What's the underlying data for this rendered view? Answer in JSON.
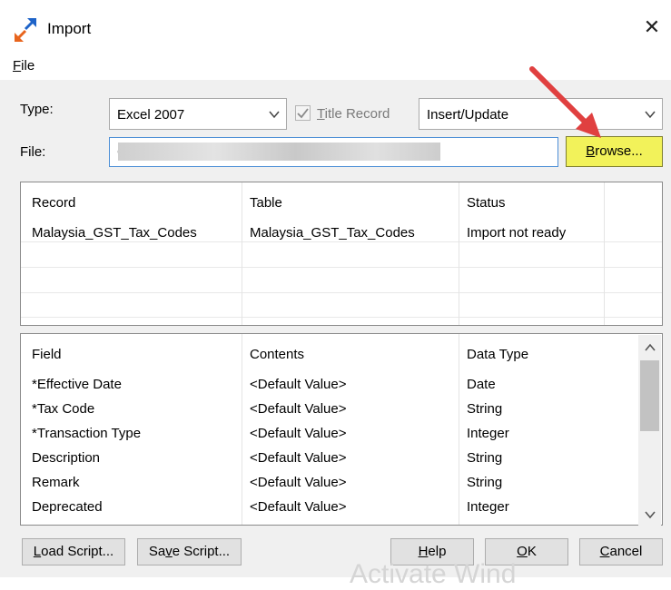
{
  "window": {
    "title": "Import",
    "close_glyph": "✕"
  },
  "menu": {
    "file_underline": "F",
    "file_rest": "ile"
  },
  "form": {
    "type_label": "Type:",
    "type_value": "Excel 2007",
    "title_record_prefix": "",
    "title_record_underline": "T",
    "title_record_rest": "itle Record",
    "mode_value": "Insert/Update",
    "file_label": "File:",
    "file_value": "C:",
    "browse_underline": "B",
    "browse_rest": "rowse..."
  },
  "records": {
    "columns": [
      "Record",
      "Table",
      "Status"
    ],
    "rows": [
      {
        "record": "Malaysia_GST_Tax_Codes",
        "table": "Malaysia_GST_Tax_Codes",
        "status": "Import not ready"
      }
    ]
  },
  "fields": {
    "columns": [
      "Field",
      "Contents",
      "Data Type"
    ],
    "rows": [
      {
        "field": "*Effective Date",
        "contents": "<Default Value>",
        "type": "Date"
      },
      {
        "field": "*Tax Code",
        "contents": "<Default Value>",
        "type": "String"
      },
      {
        "field": "*Transaction Type",
        "contents": "<Default Value>",
        "type": "Integer"
      },
      {
        "field": "Description",
        "contents": "<Default Value>",
        "type": "String"
      },
      {
        "field": "Remark",
        "contents": "<Default Value>",
        "type": "String"
      },
      {
        "field": "Deprecated",
        "contents": "<Default Value>",
        "type": "Integer"
      }
    ]
  },
  "buttons": {
    "load_underline": "L",
    "load_rest": "oad Script...",
    "save_prefix": "Sa",
    "save_underline": "v",
    "save_rest": "e Script...",
    "help_underline": "H",
    "help_rest": "elp",
    "ok_prefix": "",
    "ok_underline": "O",
    "ok_rest": "K",
    "cancel_underline": "C",
    "cancel_rest": "ancel"
  },
  "watermark": "Activate Wind",
  "colors": {
    "highlight": "#f2f25a",
    "arrow": "#e04040",
    "focus_border": "#4d8fd6"
  }
}
